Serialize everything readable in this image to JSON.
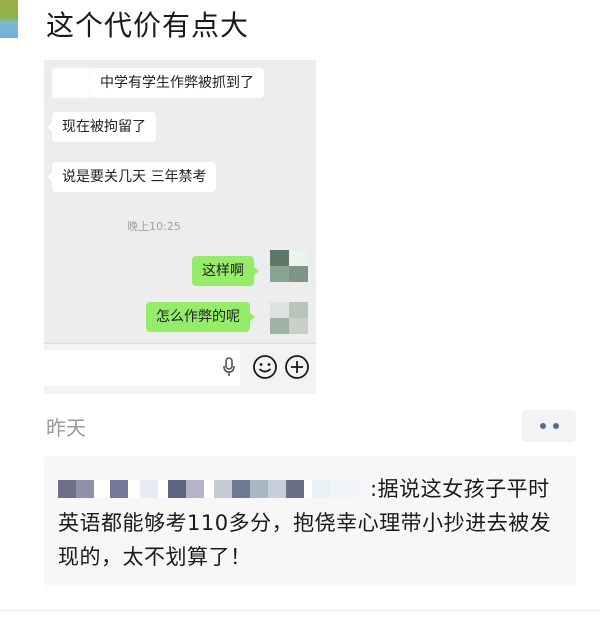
{
  "post": {
    "title": "这个代价有点大",
    "timestamp": "昨天"
  },
  "chat": {
    "incoming": [
      "中学有学生作弊被抓到了",
      "现在被拘留了",
      "说是要关几天 三年禁考"
    ],
    "time": "晚上10:25",
    "outgoing": [
      "这样啊",
      "怎么作弊的呢"
    ]
  },
  "comment": {
    "text": ":据说这女孩子平时英语都能够考110多分，抱侥幸心理带小抄进去被发现的，太不划算了！"
  },
  "icons": {
    "mic": "microphone-icon",
    "emoji": "emoji-icon",
    "plus": "plus-icon",
    "more": "more-dots-icon"
  },
  "colors": {
    "outgoing_bubble": "#95ec69",
    "link_blue": "#576b95"
  }
}
